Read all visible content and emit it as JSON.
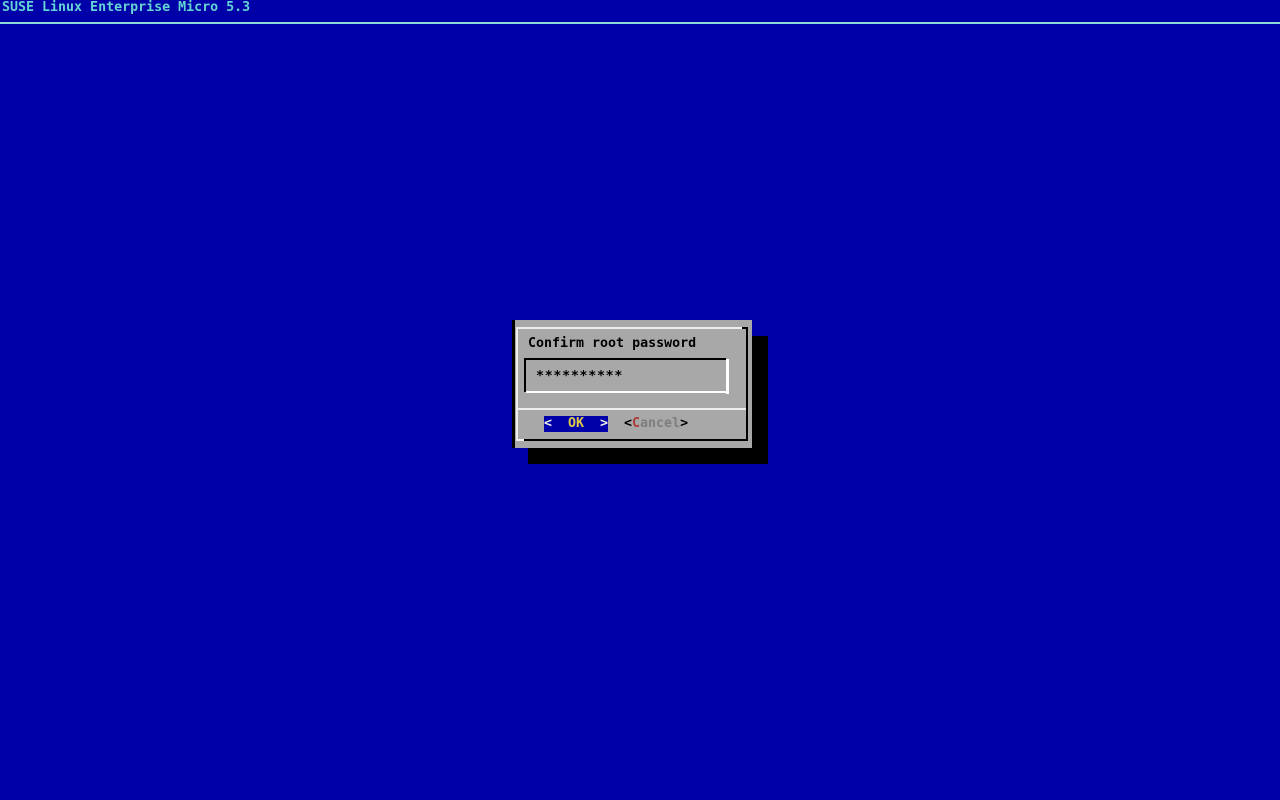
{
  "screen": {
    "title": "SUSE Linux Enterprise Micro 5.3"
  },
  "dialog": {
    "title": "Confirm root password",
    "password": {
      "masked_value": "**********"
    },
    "buttons": {
      "ok": {
        "prefix": "<  ",
        "label": "OK",
        "suffix": "  >"
      },
      "cancel": {
        "prefix": "<",
        "key": "C",
        "rest": "ancel",
        "suffix": ">"
      }
    }
  },
  "colors": {
    "background": "#0000A8",
    "header_text": "#63D3D3",
    "header_rule": "#8ADADA",
    "dialog_surface": "#A8A8A8",
    "border_highlight": "#EDEDED",
    "border_shadow": "#000000",
    "drop_shadow": "#000000",
    "ok_button_background": "#0000A8",
    "ok_button_label": "#DFCB49",
    "ok_button_arrows": "#EDEDED",
    "cancel_key": "#AC3A3A",
    "cancel_label": "#7E7E7E",
    "text": "#000000"
  }
}
